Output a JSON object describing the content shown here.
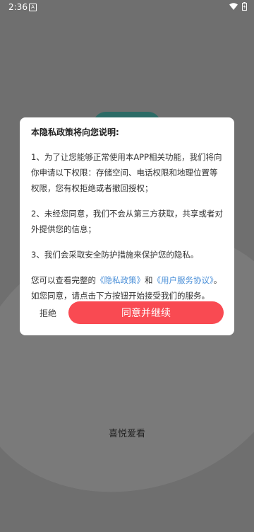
{
  "status_bar": {
    "time": "2:36",
    "notification_icon": "A",
    "wifi": "wifi-icon",
    "battery": "battery-icon"
  },
  "dialog": {
    "title": "本隐私政策将向您说明:",
    "items": [
      "1、为了让您能够正常使用本APP相关功能，我们将向你申请以下权限：存储空间、电话权限和地理位置等权限，您有权拒绝或者撤回授权；",
      "2、未经您同意，我们不会从第三方获取，共享或者对外提供您的信息；",
      "3、我们会采取安全防护措施来保护您的隐私。"
    ],
    "notice_prefix": "您可以查看完整的",
    "privacy_link": "《隐私政策》",
    "notice_and": "和",
    "terms_link": "《用户服务协议》",
    "notice_suffix": "。如您同意，请点击下方按钮开始接受我们的服务。",
    "reject_label": "拒绝",
    "agree_label": "同意并继续"
  },
  "app_name": "喜悦爱看",
  "colors": {
    "accent": "#f94a52",
    "link": "#4a8fd8",
    "overlay": "#6f6f6f"
  }
}
